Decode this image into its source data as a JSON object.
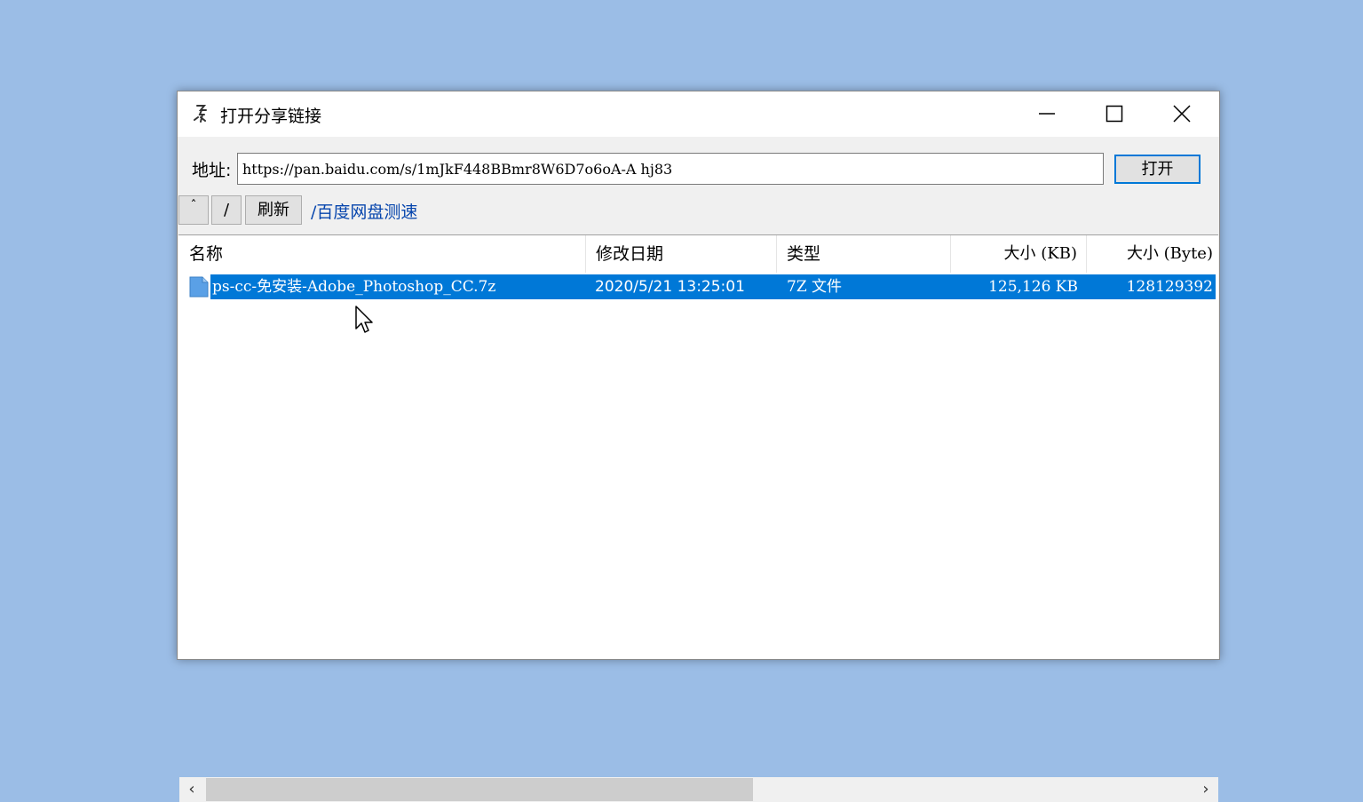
{
  "window": {
    "title": "打开分享链接",
    "minimize_icon": "minimize-icon",
    "maximize_icon": "maximize-icon",
    "close_icon": "close-icon"
  },
  "address": {
    "label": "地址:",
    "value": "https://pan.baidu.com/s/1mJkF448BBmr8W6D7o6oA-A hj83",
    "open_label": "打开"
  },
  "toolbar": {
    "up_label": "ˆ",
    "root_label": "/",
    "refresh_label": "刷新",
    "speed_link": "/百度网盘测速"
  },
  "list": {
    "columns": [
      "名称",
      "修改日期",
      "类型",
      "大小 (KB)",
      "大小 (Byte)"
    ],
    "rows": [
      {
        "name": "ps-cc-免安装-Adobe_Photoshop_CC.7z",
        "date": "2020/5/21 13:25:01",
        "type": "7Z 文件",
        "size_kb": "125,126 KB",
        "size_byte": "128129392",
        "selected": true
      }
    ]
  },
  "scrollbar": {
    "left_arrow": "‹",
    "right_arrow": "›"
  },
  "colors": {
    "desktop": "#9bbde6",
    "selection": "#0078d7",
    "link": "#0645ad"
  }
}
